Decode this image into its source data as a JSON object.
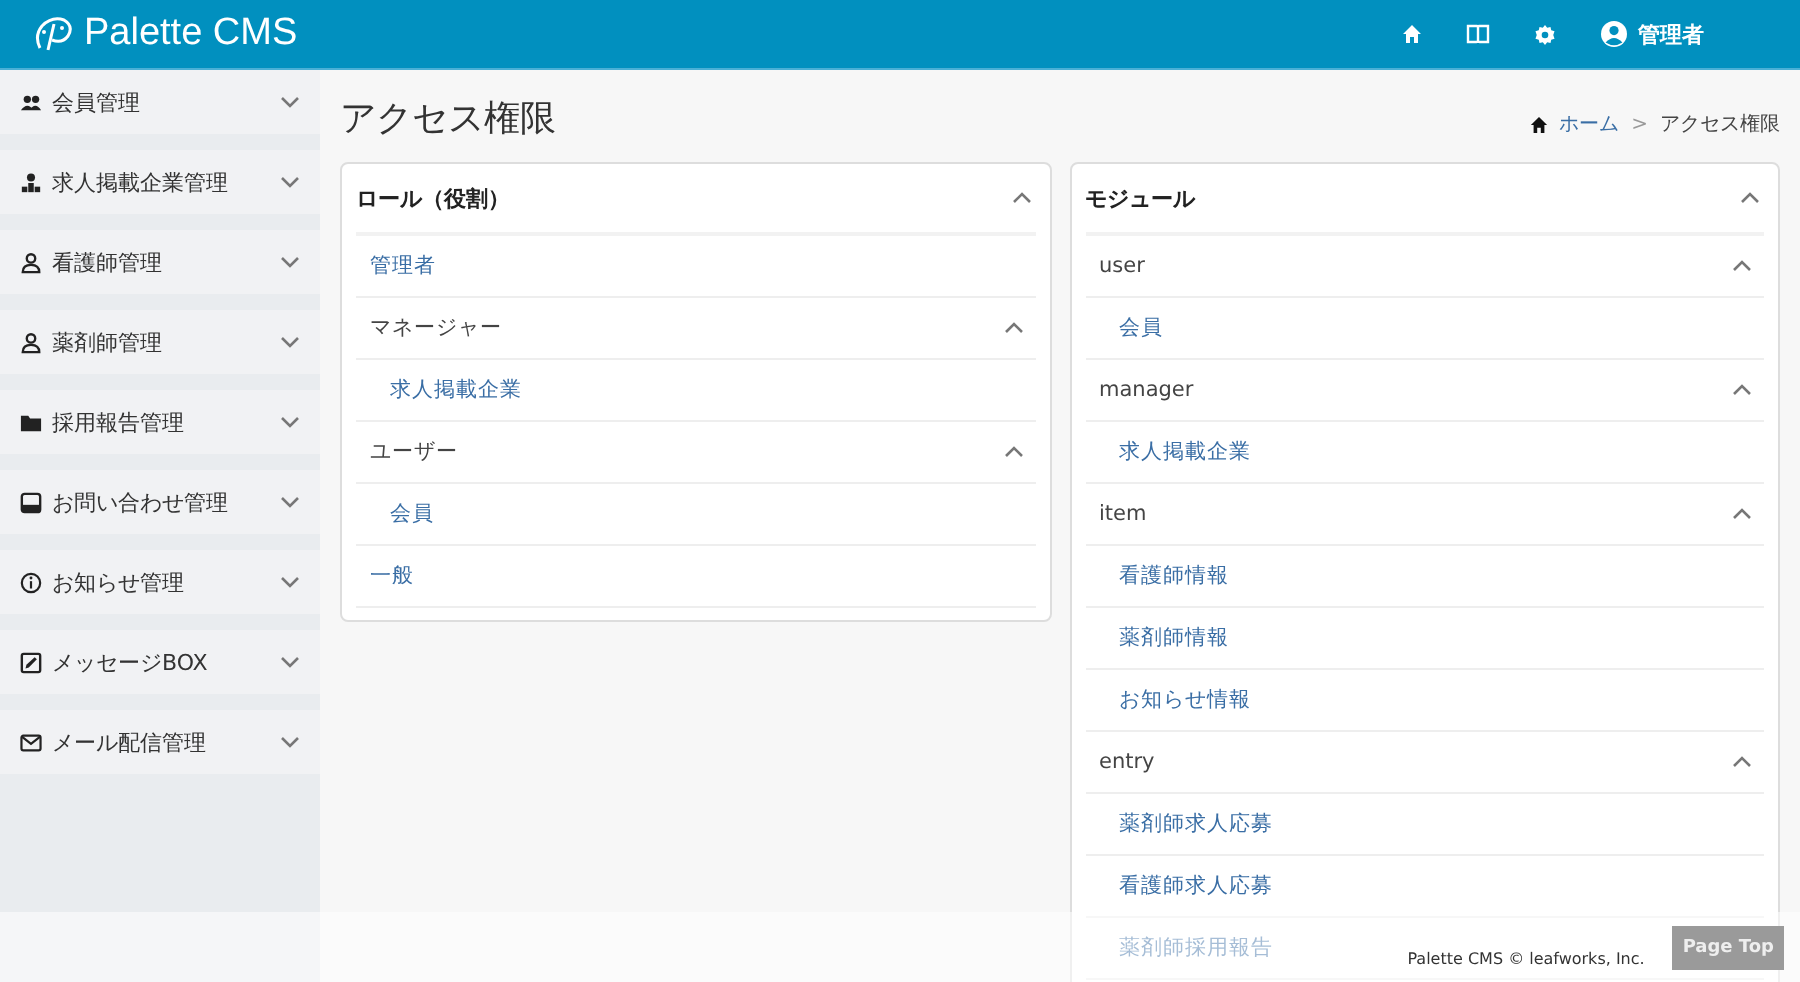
{
  "header": {
    "logo": "Palette CMS",
    "user": "管理者"
  },
  "sidebar": {
    "items": [
      {
        "label": "会員管理",
        "kind": "users",
        "expanded": false
      },
      {
        "label": "求人掲載企業管理",
        "kind": "org",
        "expanded": false
      },
      {
        "label": "看護師管理",
        "kind": "person",
        "expanded": false
      },
      {
        "label": "薬剤師管理",
        "kind": "person",
        "expanded": false
      },
      {
        "label": "採用報告管理",
        "kind": "folder",
        "expanded": false
      },
      {
        "label": "お問い合わせ管理",
        "kind": "inbox",
        "expanded": false
      },
      {
        "label": "お知らせ管理",
        "kind": "info",
        "expanded": false
      },
      {
        "label": "メッセージBOX",
        "kind": "edit",
        "expanded": false
      },
      {
        "label": "メール配信管理",
        "kind": "mail",
        "expanded": false
      }
    ]
  },
  "page": {
    "title": "アクセス権限",
    "breadcrumb": [
      {
        "label": "ホーム",
        "link": true
      },
      {
        "label": "アクセス権限",
        "link": false
      }
    ],
    "separator": ">"
  },
  "cards": [
    {
      "title": "ロール（役割）",
      "expanded": true,
      "items": [
        {
          "label": "管理者",
          "link": true
        },
        {
          "label": "マネージャー",
          "link": false,
          "expanded": true,
          "children": [
            {
              "label": "求人掲載企業",
              "link": true
            }
          ]
        },
        {
          "label": "ユーザー",
          "link": false,
          "expanded": true,
          "children": [
            {
              "label": "会員",
              "link": true
            }
          ]
        },
        {
          "label": "一般",
          "link": true
        }
      ]
    },
    {
      "title": "モジュール",
      "expanded": true,
      "items": [
        {
          "label": "user",
          "link": false,
          "expanded": true,
          "children": [
            {
              "label": "会員",
              "link": true
            }
          ]
        },
        {
          "label": "manager",
          "link": false,
          "expanded": true,
          "children": [
            {
              "label": "求人掲載企業",
              "link": true
            }
          ]
        },
        {
          "label": "item",
          "link": false,
          "expanded": true,
          "children": [
            {
              "label": "看護師情報",
              "link": true
            },
            {
              "label": "薬剤師情報",
              "link": true
            },
            {
              "label": "お知らせ情報",
              "link": true
            }
          ]
        },
        {
          "label": "entry",
          "link": false,
          "expanded": true,
          "children": [
            {
              "label": "薬剤師求人応募",
              "link": true
            },
            {
              "label": "看護師求人応募",
              "link": true
            },
            {
              "label": "薬剤師採用報告",
              "link": true
            }
          ]
        }
      ]
    }
  ],
  "footer": {
    "copyright": "Palette CMS © leafworks, Inc.",
    "page_top": "Page Top"
  }
}
